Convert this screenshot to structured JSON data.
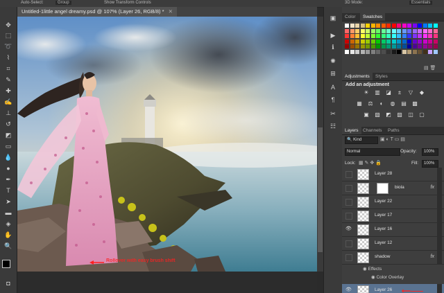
{
  "options_bar": {
    "auto_select_label": "Auto-Select:",
    "auto_select_value": "Group",
    "show_transform_label": "Show Transform Controls",
    "mode_3d_label": "3D Mode:",
    "workspace": "Essentials"
  },
  "document": {
    "tab_title": "Untitled-1little angel dreamy.psd @ 107% (Layer 26, RGB/8) *",
    "annotation": "Rollover with easy brush shift"
  },
  "color_panel": {
    "tabs": [
      "Color",
      "Swatches"
    ],
    "active_tab": "Swatches",
    "swatch_rows": [
      [
        "#ffffff",
        "#f2e4c9",
        "#e8d4a8",
        "#d7c185",
        "#ffd200",
        "#ffb400",
        "#ff8c00",
        "#ff5a00",
        "#ff2800",
        "#ff0000",
        "#ff0078",
        "#ff00c8",
        "#c800ff",
        "#7800ff",
        "#0000ff",
        "#0078ff",
        "#00c8ff",
        "#00ffff"
      ],
      [
        "#ff6666",
        "#ff9966",
        "#ffcc66",
        "#ffff66",
        "#ccff66",
        "#99ff66",
        "#66ff66",
        "#66ff99",
        "#66ffcc",
        "#66ffff",
        "#66ccff",
        "#6699ff",
        "#6666ff",
        "#9966ff",
        "#cc66ff",
        "#ff66ff",
        "#ff66cc",
        "#ff6699"
      ],
      [
        "#ff3333",
        "#ff8033",
        "#ffbf33",
        "#ffff33",
        "#bfff33",
        "#80ff33",
        "#33ff33",
        "#33ff80",
        "#33ffbf",
        "#33ffff",
        "#33bfff",
        "#3380ff",
        "#3333ff",
        "#8033ff",
        "#bf33ff",
        "#ff33ff",
        "#ff33bf",
        "#ff3380"
      ],
      [
        "#cc0000",
        "#cc6600",
        "#cc9900",
        "#cccc00",
        "#99cc00",
        "#66cc00",
        "#00cc00",
        "#00cc66",
        "#00cc99",
        "#00cccc",
        "#0099cc",
        "#0066cc",
        "#0000cc",
        "#6600cc",
        "#9900cc",
        "#cc00cc",
        "#cc0099",
        "#cc0066"
      ],
      [
        "#990000",
        "#994c00",
        "#997300",
        "#999900",
        "#739900",
        "#4c9900",
        "#009900",
        "#00994c",
        "#009973",
        "#009999",
        "#007399",
        "#004c99",
        "#000099",
        "#4c0099",
        "#730099",
        "#990099",
        "#990073",
        "#99004c"
      ],
      [
        "#ffffff",
        "#e6e6e6",
        "#cccccc",
        "#b3b3b3",
        "#999999",
        "#808080",
        "#666666",
        "#4d4d4d",
        "#333333",
        "#1a1a1a",
        "#000000",
        "#d9c7a6",
        "#b39b72",
        "#8c7350",
        "#665033",
        "#40301a",
        "#c8a0ff",
        "#a0c8ff"
      ]
    ]
  },
  "adjustments_panel": {
    "tabs": [
      "Adjustments",
      "Styles"
    ],
    "active_tab": "Adjustments",
    "heading": "Add an adjustment",
    "row1_icons": [
      "brightness-contrast-icon",
      "levels-icon",
      "curves-icon",
      "exposure-icon",
      "vibrance-icon",
      "hsl-icon"
    ],
    "row2_icons": [
      "hue-saturation-icon",
      "color-balance-icon",
      "black-white-icon",
      "photo-filter-icon",
      "channel-mixer-icon",
      "color-lookup-icon"
    ],
    "row3_icons": [
      "invert-icon",
      "posterize-icon",
      "threshold-icon",
      "gradient-map-icon",
      "selective-color-icon",
      "curves-alt-icon"
    ],
    "row1_glyphs": [
      "☀",
      "▥",
      "◪",
      "±",
      "▽",
      "◆"
    ],
    "row2_glyphs": [
      "▦",
      "⚖",
      "◐",
      "◍",
      "▤",
      "▩"
    ],
    "row3_glyphs": [
      "▣",
      "▧",
      "◩",
      "▨",
      "◫",
      "▢"
    ]
  },
  "layers_panel": {
    "tabs": [
      "Layers",
      "Channels",
      "Paths"
    ],
    "active_tab": "Layers",
    "filter_label": "Kind",
    "blend_mode": "Normal",
    "opacity_label": "Opacity:",
    "opacity_value": "100%",
    "lock_label": "Lock:",
    "fill_label": "Fill:",
    "fill_value": "100%",
    "layers": [
      {
        "name": "Layer 28",
        "visible": false,
        "fx": false,
        "mask": false,
        "selected": false
      },
      {
        "name": "biola",
        "visible": false,
        "fx": true,
        "mask": true,
        "selected": false
      },
      {
        "name": "Layer 22",
        "visible": false,
        "fx": false,
        "mask": false,
        "selected": false
      },
      {
        "name": "Layer 17",
        "visible": false,
        "fx": false,
        "mask": false,
        "selected": false
      },
      {
        "name": "Layer 16",
        "visible": true,
        "fx": false,
        "mask": false,
        "selected": false
      },
      {
        "name": "Layer 12",
        "visible": false,
        "fx": false,
        "mask": false,
        "selected": false
      },
      {
        "name": "shadow",
        "visible": false,
        "fx": true,
        "mask": false,
        "selected": false
      },
      {
        "name": "Layer 26",
        "visible": true,
        "fx": false,
        "mask": false,
        "selected": true
      }
    ],
    "effects_label": "Effects",
    "effect_item": "Color Overlay",
    "fx_label": "fx"
  },
  "colors": {
    "annotation": "#ff2020",
    "selection": "#5a7391",
    "panel_bg": "#3e3e3e"
  }
}
